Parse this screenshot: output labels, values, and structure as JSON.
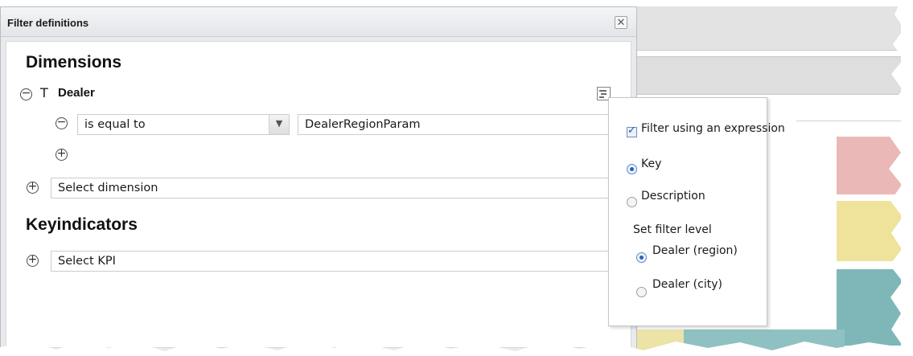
{
  "dialog": {
    "title": "Filter definitions",
    "close_glyph": "✕"
  },
  "dimensions": {
    "heading": "Dimensions",
    "type_glyph": "T",
    "dealer_label": "Dealer",
    "operator_value": "is equal to",
    "parameter_value": "DealerRegionParam",
    "select_dimension_placeholder": "Select dimension"
  },
  "keyindicators": {
    "heading": "Keyindicators",
    "select_kpi_placeholder": "Select KPI"
  },
  "popup": {
    "filter_expression_label": "Filter using an expression",
    "filter_expression_checked": true,
    "key_label": "Key",
    "description_label": "Description",
    "selected_value_type": "Key",
    "filter_level_heading": "Set filter level",
    "level_region_label": "Dealer (region)",
    "level_city_label": "Dealer (city)",
    "selected_level": "Dealer (region)"
  },
  "icons": {
    "collapse": "minus-circle-icon",
    "add": "plus-circle-icon",
    "text_type": "text-type-icon",
    "expression": "expression-icon",
    "dropdown": "chevron-down-icon",
    "close": "close-icon"
  },
  "colors": {
    "accent": "#2b61b3",
    "pink_block": "#eab8b6",
    "yellow_block": "#efe29a",
    "teal_block": "#7fb7b8"
  }
}
